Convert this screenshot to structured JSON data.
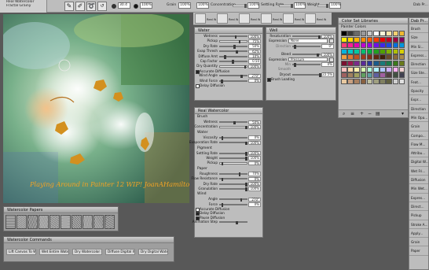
{
  "toolbar": {
    "categories": [
      "Real Watercolor",
      "Fractal Grainy",
      ""
    ],
    "size_value": "30.4",
    "opacity_value": "100%",
    "grain_label": "Grain",
    "grain_value": "100%",
    "blend_value": "100%",
    "concentration_label": "Concentration",
    "concentration_value": "100%",
    "settling_rate_label": "Settling Rate",
    "settling_rate_value": "100%",
    "weight_label": "Weight",
    "weight_value": "100%",
    "dabs_label": "Dab Pr...",
    "brush_variants": [
      "Real Wa...",
      "Real Wa...",
      "Real Wa...",
      "Real Wa...",
      "Real Wa...",
      "Real Wa..."
    ]
  },
  "canvas": {
    "caption": "Playing Around in Painter 12 WIP! JoanAHamilton.com"
  },
  "water_panel": {
    "title": "Water",
    "rows": [
      {
        "label": "Wetness",
        "value": "100%",
        "pos": 0.55
      },
      {
        "label": "Pickup",
        "value": "75%",
        "pos": 0.7
      },
      {
        "label": "Dry Rate",
        "value": "50%",
        "pos": 0.5
      },
      {
        "label": "Evap Thresh",
        "value": "62%",
        "pos": 0.6
      },
      {
        "label": "Diffuse Amt",
        "value": "10%",
        "pos": 0.15
      },
      {
        "label": "Cap Factor",
        "value": "0.50",
        "pos": 0.45
      },
      {
        "label": "Dry Quantity",
        "value": "100%",
        "pos": 0.9
      }
    ],
    "accurate_label": "Accurate Diffusion",
    "wind_angle_label": "Wind Angle",
    "wind_angle_value": "270°",
    "wind_force_label": "Wind Force",
    "wind_force_value": "0%",
    "delay_label": "Delay Diffusion"
  },
  "well_panel": {
    "title": "Well",
    "rows": [
      {
        "label": "Resaturation",
        "value": "100%",
        "pos": 0.9
      },
      {
        "label": "Bleed",
        "value": "100%",
        "pos": 0.85
      },
      {
        "label": "Dryout",
        "value": "22.5%",
        "pos": 0.95
      }
    ],
    "expression_label": "Expression",
    "expression_1": "None",
    "direction_label": "Direction",
    "direction_value": "0°",
    "expression_2": "Pressure",
    "min_label": "Min",
    "min_value": "0%",
    "smooth_label": "Smooth",
    "brush_loading": "Brush Loading"
  },
  "real_watercolor_panel": {
    "title": "Real Watercolor",
    "brush": {
      "label": "Brush",
      "rows": [
        {
          "label": "Wetness",
          "value": "50%",
          "pos": 0.5
        },
        {
          "label": "Concentration",
          "value": "100%",
          "pos": 0.95
        }
      ]
    },
    "water": {
      "label": "Water",
      "rows": [
        {
          "label": "Viscosity",
          "value": "0%",
          "pos": 0.05
        },
        {
          "label": "Evaporation Rate",
          "value": "100%",
          "pos": 0.95
        }
      ]
    },
    "pigment": {
      "label": "Pigment",
      "rows": [
        {
          "label": "Settling Rate",
          "value": "100%",
          "pos": 0.95
        },
        {
          "label": "Weight",
          "value": "100%",
          "pos": 0.95
        },
        {
          "label": "Pickup",
          "value": "0%",
          "pos": 0.05
        }
      ]
    },
    "paper": {
      "label": "Paper",
      "rows": [
        {
          "label": "Roughness",
          "value": "70%",
          "pos": 0.7
        },
        {
          "label": "Flow Resistance",
          "value": "0%",
          "pos": 0.05
        },
        {
          "label": "Dry Rate",
          "value": "100%",
          "pos": 0.95
        },
        {
          "label": "Granulation",
          "value": "100%",
          "pos": 0.95
        }
      ]
    },
    "wind": {
      "label": "Wind",
      "rows": [
        {
          "label": "Angle",
          "value": "270°",
          "pos": 0.75
        },
        {
          "label": "Force",
          "value": "0%",
          "pos": 0.05
        }
      ]
    },
    "accurate_label": "Accurate Diffusion",
    "delay_label": "Delay Diffusion",
    "pause_label": "Pause Diffusion",
    "animation_label": "Animation Step"
  },
  "color_panel": {
    "title": "Color Set Libraries",
    "set_name": "Painter Colors"
  },
  "papers_strip": {
    "title": "Watercolor Papers"
  },
  "commands_strip": {
    "title": "Watercolor Commands",
    "buttons": [
      "Lift Canvas To Wa...",
      "Wet Entire Water...",
      "Dry Watercolor L...",
      "Diffuse Digital W...",
      "Dry Digital Water..."
    ]
  },
  "right_panel": {
    "title": "Dab Pr...",
    "items": [
      "Brush",
      "Size",
      "Min Si...",
      "Express...",
      "Direction",
      "Size Ste...",
      "Feat...",
      "Opacity",
      "Expr...",
      "Direction",
      "Min Opa...",
      "Grain",
      "Compo...",
      "Flow M...",
      "Attribu...",
      "Digital W...",
      "Wet Fri...",
      "Diffusion",
      "Min Wet...",
      "Expres...",
      "Direct...",
      "Pickup",
      "Stroke A...",
      "Apply...",
      "Grain",
      "Paper"
    ]
  }
}
